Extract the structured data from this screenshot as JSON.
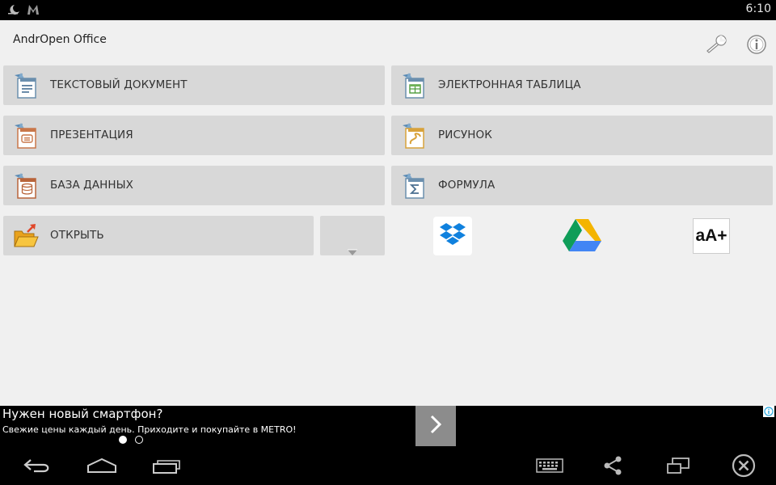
{
  "status_bar": {
    "time": "6:10",
    "icons": [
      "notification-moon-icon",
      "notification-m-icon"
    ]
  },
  "app": {
    "title": "AndrOpen Office",
    "header_icons": [
      "settings-wrench-icon",
      "info-icon"
    ]
  },
  "tiles": {
    "writer": "ТЕКСТОВЫЙ ДОКУМЕНТ",
    "calc": "ЭЛЕКТРОННАЯ ТАБЛИЦА",
    "impress": "ПРЕЗЕНТАЦИЯ",
    "draw": "РИСУНОК",
    "base": "БАЗА ДАННЫХ",
    "math": "ФОРМУЛА",
    "open": "ОТКРЫТЬ"
  },
  "cloud_services": [
    "dropbox-icon",
    "google-drive-icon"
  ],
  "font_size_button": "aA+",
  "ad": {
    "title": "Нужен новый смартфон?",
    "subtitle": "Свежие цены каждый день. Приходите и покупайте в METRO!",
    "pages": 2,
    "current_page": 1
  },
  "nav_bar": {
    "icons": [
      "back-icon",
      "home-icon",
      "recent-apps-icon",
      "keyboard-icon",
      "share-icon",
      "screen-mirror-icon",
      "close-circle-icon"
    ]
  },
  "colors": {
    "tile_bg": "#d8d8d8",
    "screen_bg": "#f0f0f0",
    "dropbox_blue": "#1081de",
    "drive_green": "#0f9d58",
    "drive_yellow": "#f4b400",
    "drive_blue": "#4285f4"
  }
}
